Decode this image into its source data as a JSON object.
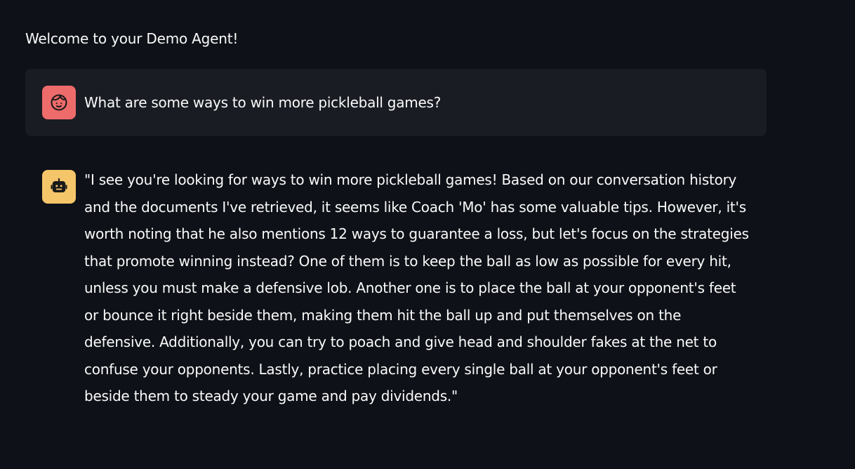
{
  "app": {
    "welcome": "Welcome to your Demo Agent!"
  },
  "chat": {
    "messages": [
      {
        "role": "user",
        "avatar_icon": "user-face-icon",
        "avatar_color": "#ee6b6b",
        "text": "What are some ways to win more pickleball games?"
      },
      {
        "role": "assistant",
        "avatar_icon": "robot-icon",
        "avatar_color": "#f5c56a",
        "text": "\"I see you're looking for ways to win more pickleball games! Based on our conversation history and the documents I've retrieved, it seems like Coach 'Mo' has some valuable tips. However, it's worth noting that he also mentions 12 ways to guarantee a loss, but let's focus on the strategies that promote winning instead? One of them is to keep the ball as low as possible for every hit, unless you must make a defensive lob. Another one is to place the ball at your opponent's feet or bounce it right beside them, making them hit the ball up and put themselves on the defensive. Additionally, you can try to poach and give head and shoulder fakes at the net to confuse your opponents. Lastly, practice placing every single ball at your opponent's feet or beside them to steady your game and pay dividends.\""
      }
    ]
  },
  "theme": {
    "background": "#0e1117",
    "user_bubble": "#1a1c24",
    "text": "#fafafa"
  }
}
